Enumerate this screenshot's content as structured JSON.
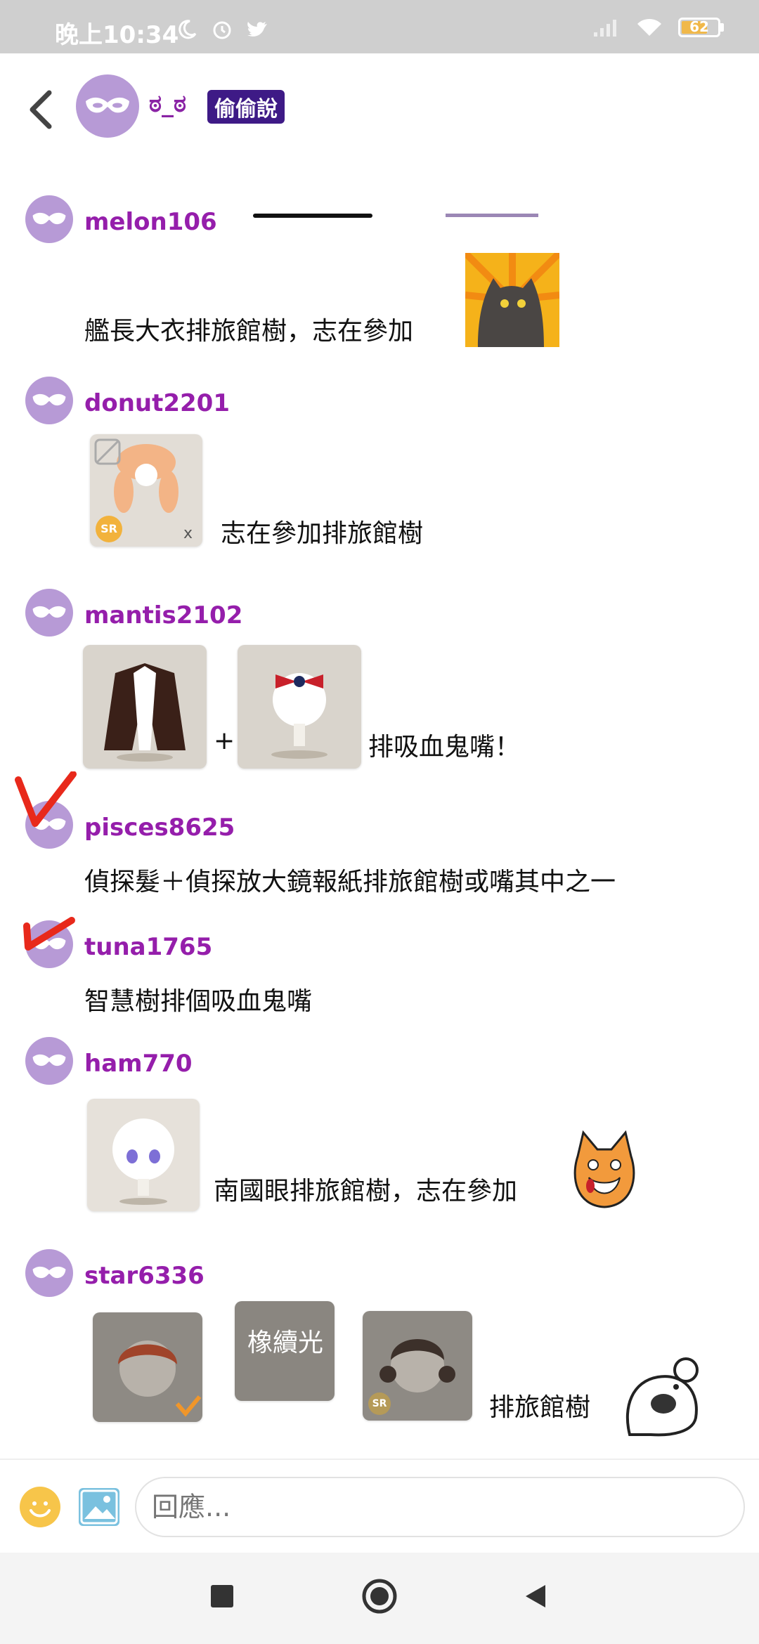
{
  "status_bar": {
    "time": "晚上10:34",
    "battery": "62"
  },
  "header": {
    "name": "ಠ_ಠ",
    "badge": "偷偷說"
  },
  "messages": [
    {
      "username": "melon106",
      "text": "艦長大衣排旅館樹，志在參加"
    },
    {
      "username": "donut2201",
      "text": "志在參加排旅館樹",
      "thumb_badge": "SR",
      "thumb_mark": "x"
    },
    {
      "username": "mantis2102",
      "plus": "+",
      "text": "排吸血鬼嘴！"
    },
    {
      "username": "pisces8625",
      "text": "偵探髮＋偵探放大鏡報紙排旅館樹或嘴其中之一"
    },
    {
      "username": "tuna1765",
      "text": "智慧樹排個吸血鬼嘴"
    },
    {
      "username": "ham770",
      "text": "南國眼排旅館樹，志在參加"
    },
    {
      "username": "star6336",
      "thumb_label": "橡續光",
      "thumb_badge": "SR",
      "text": "排旅館樹"
    }
  ],
  "composer": {
    "placeholder": "回應..."
  },
  "icons": {
    "back": "chevron-left-icon",
    "avatar": "mask-icon",
    "emoji": "smiley-icon",
    "image": "image-icon",
    "nav_recent": "square-icon",
    "nav_home": "circle-icon",
    "nav_back": "triangle-back-icon"
  },
  "colors": {
    "username": "#951eab",
    "badge_bg": "#3e1a86",
    "avatar_bg": "#b79ad6",
    "annotation": "#e8291b"
  }
}
